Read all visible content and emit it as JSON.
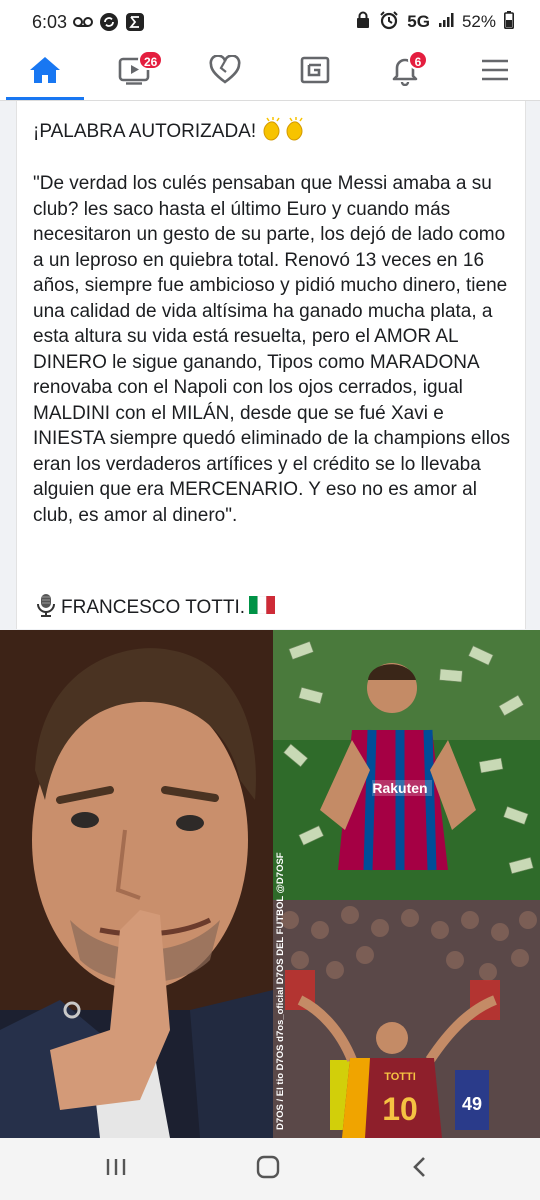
{
  "status_bar": {
    "time": "6:03",
    "network": "5G",
    "battery": "52%"
  },
  "nav": {
    "video_badge": "26",
    "notifications_badge": "6",
    "accent_color": "#1877f2",
    "badge_color": "#e41e3f"
  },
  "post": {
    "headline": "¡PALABRA AUTORIZADA!",
    "headline_emoji": "clapping-hands-icon",
    "body": "\"De verdad los culés pensaban que Messi amaba a su club? les saco hasta el último Euro y cuando más necesitaron un gesto de su parte, los dejó de lado como a un leproso en quiebra total. Renovó 13 veces en 16 años, siempre fue ambicioso y pidió mucho dinero, tiene una calidad de vida altísima ha ganado mucha plata, a esta altura su vida está resuelta, pero el AMOR AL DINERO le sigue ganando, Tipos como MARADONA renovaba con el Napoli con los ojos cerrados, igual MALDINI con el MILÁN, desde que se fué Xavi e INIESTA siempre quedó eliminado de la champions ellos eran los verdaderos artífices y el crédito se lo llevaba alguien que era MERCENARIO. Y eso no es amor al club, es amor al dinero\".",
    "signature": "FRANCESCO TOTTI."
  },
  "image": {
    "watermark": "D7OS / El tio D7OS  d7os_oficial  D7OS DEL FUTBOL  @D7OSF",
    "jersey_sponsor": "Rakuten",
    "jersey_name": "TOTTI",
    "jersey_number": "10",
    "fan_number": "49"
  }
}
